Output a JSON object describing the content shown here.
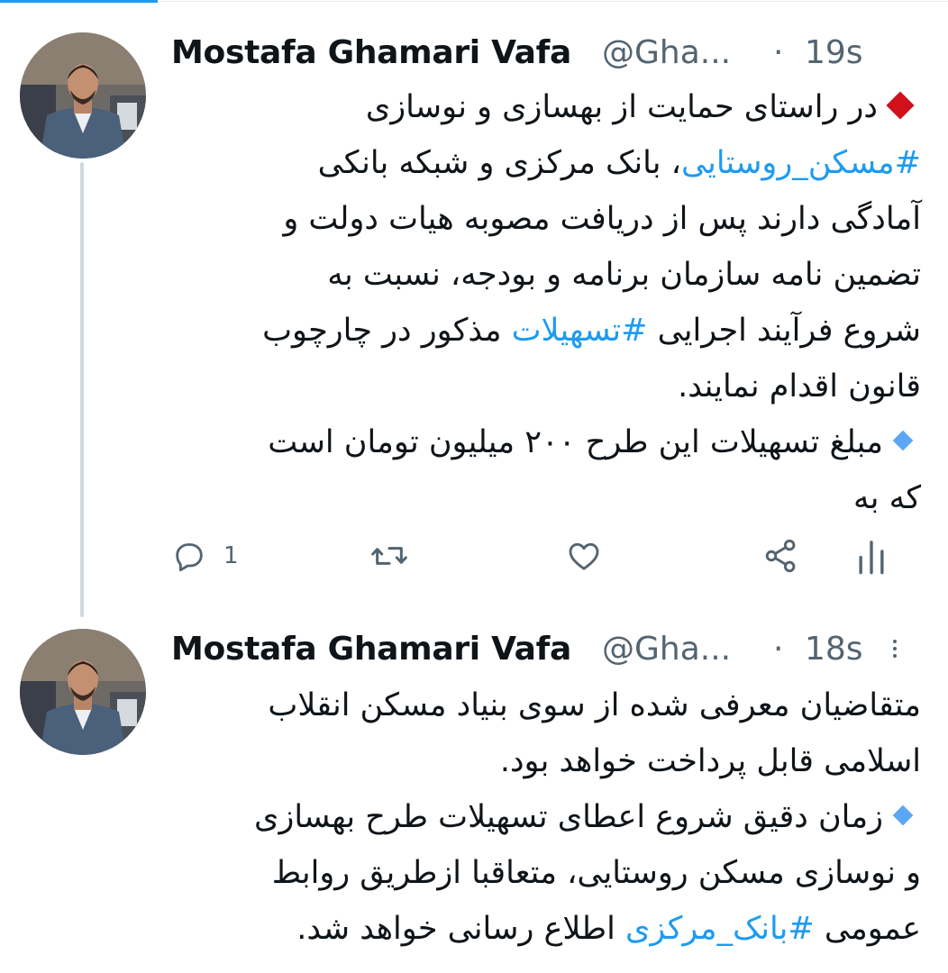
{
  "tweets": [
    {
      "author": "Mostafa Ghamari Vafa",
      "handle": "@Gha...",
      "separator": "·",
      "time": "19s",
      "lines": [
        {
          "marker": "red-diamond",
          "text": "در راستای حمایت از بهسازی و نوسازی"
        },
        {
          "hashtag": "#مسکن_روستایی",
          "text": "، بانک مرکزی و شبکه بانکی"
        },
        {
          "text": "آمادگی دارند پس از دریافت مصوبه هیات دولت و"
        },
        {
          "text": "تضمین نامه سازمان برنامه و بودجه، نسبت به"
        },
        {
          "pre": "شروع فرآیند اجرایی ",
          "hashtag": "#تسهیلات",
          "text": " مذکور در چارچوب"
        },
        {
          "text": "قانون اقدام نمایند."
        },
        {
          "marker": "blue-diamond",
          "text": "مبلغ تسهیلات این طرح ۲۰۰ میلیون تومان است"
        },
        {
          "text": "که به"
        }
      ],
      "actions": {
        "reply_icon": "reply-icon",
        "reply_count": "1",
        "retweet_icon": "retweet-icon",
        "like_icon": "heart-icon",
        "share_icon": "share-icon",
        "analytics_icon": "analytics-icon"
      }
    },
    {
      "author": "Mostafa Ghamari Vafa",
      "handle": "@Gha...",
      "separator": "·",
      "time": "18s",
      "lines": [
        {
          "text": "متقاضیان معرفی شده از سوی بنیاد مسکن انقلاب"
        },
        {
          "text": "اسلامی قابل پرداخت خواهد بود."
        },
        {
          "marker": "blue-diamond",
          "text": "زمان دقیق شروع اعطای تسهیلات طرح بهسازی"
        },
        {
          "text": "و نوسازی مسکن روستایی، متعاقبا ازطریق روابط"
        },
        {
          "pre": "عمومی ",
          "hashtag": "#بانک_مرکزی",
          "text": " اطلاع رسانی خواهد شد."
        }
      ]
    }
  ],
  "colors": {
    "accent": "#1d9bf0",
    "text": "#0f1419",
    "secondary": "#536471",
    "red_marker": "#d0101a",
    "blue_marker": "#5da6f5"
  }
}
